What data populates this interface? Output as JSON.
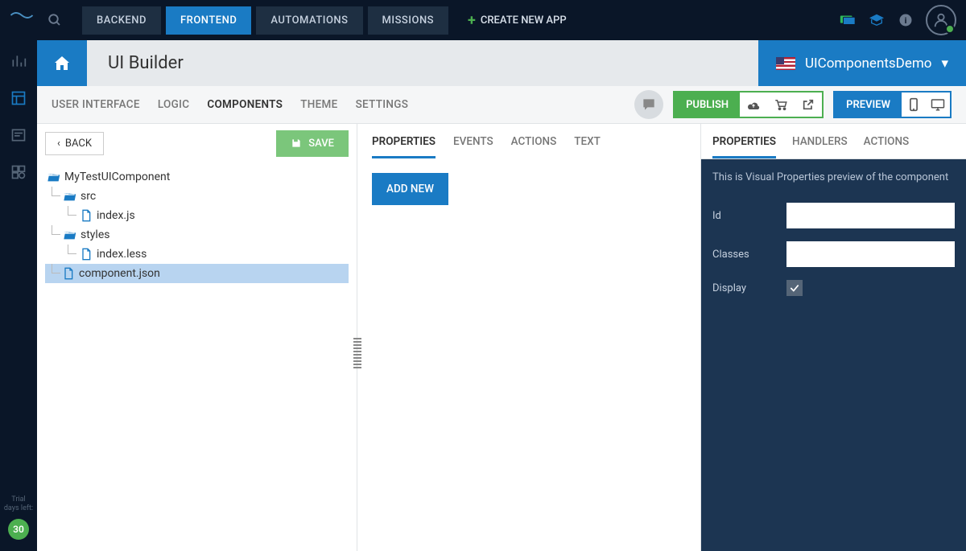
{
  "topbar": {
    "nav": [
      "BACKEND",
      "FRONTEND",
      "AUTOMATIONS",
      "MISSIONS"
    ],
    "nav_active": 1,
    "create_app": "CREATE NEW APP"
  },
  "left_rail": {
    "trial_label": "Trial days left:",
    "trial_days": "30"
  },
  "title_bar": {
    "title": "UI Builder",
    "app_name": "UIComponentsDemo"
  },
  "toolbar": {
    "tabs": [
      "USER INTERFACE",
      "LOGIC",
      "COMPONENTS",
      "THEME",
      "SETTINGS"
    ],
    "active_tab": 2,
    "publish": "PUBLISH",
    "preview": "PREVIEW"
  },
  "left_panel": {
    "back": "BACK",
    "save": "SAVE",
    "tree": {
      "root": "MyTestUIComponent",
      "src": "src",
      "index_js": "index.js",
      "styles": "styles",
      "index_less": "index.less",
      "component_json": "component.json"
    }
  },
  "mid_panel": {
    "tabs": [
      "PROPERTIES",
      "EVENTS",
      "ACTIONS",
      "TEXT"
    ],
    "active_tab": 0,
    "add_new": "ADD NEW"
  },
  "right_panel": {
    "tabs": [
      "PROPERTIES",
      "HANDLERS",
      "ACTIONS"
    ],
    "active_tab": 0,
    "description": "This is Visual Properties preview of the component",
    "fields": {
      "id_label": "Id",
      "classes_label": "Classes",
      "display_label": "Display"
    },
    "display_checked": true
  }
}
